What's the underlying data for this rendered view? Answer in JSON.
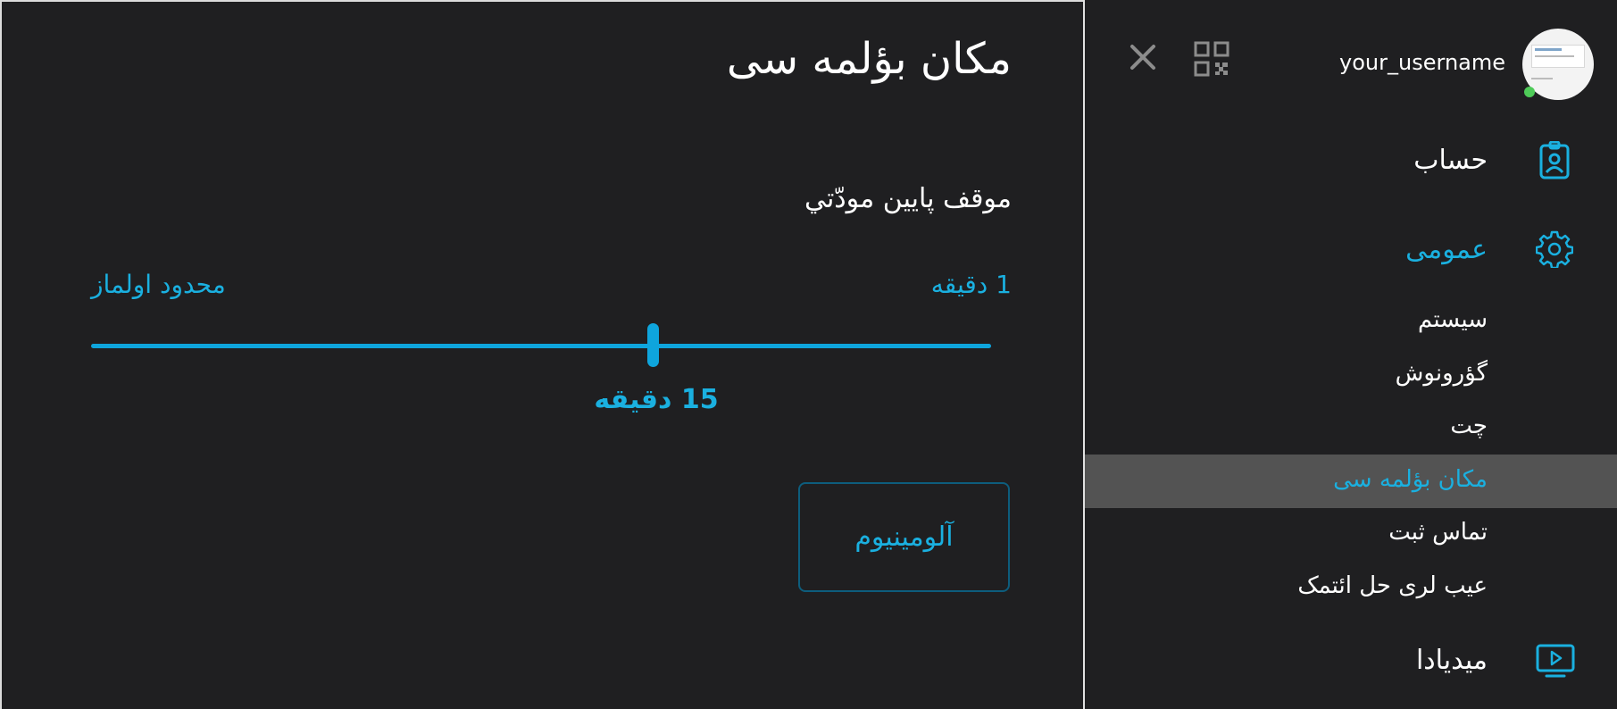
{
  "settings": {
    "title": "مکان بؤلمه سی",
    "setting_label": "موقف پایین مودّتي",
    "range_min_label": "1 دقیقه",
    "range_max_label": "محدود اولماز",
    "slider_value_label": "15 دقیقه",
    "slider_value": 15,
    "button_label": "آلومینیوم"
  },
  "sidebar": {
    "username": "your_username",
    "nav": [
      {
        "label": "حساب",
        "icon": "id-badge-icon"
      },
      {
        "label": "عمومی",
        "icon": "gear-icon"
      },
      {
        "label": "میدیادا",
        "icon": "play-screen-icon"
      }
    ],
    "sub_items": [
      {
        "label": "سیستم"
      },
      {
        "label": "گؤرونوش"
      },
      {
        "label": "چت"
      },
      {
        "label": "مکان بؤلمه سی"
      },
      {
        "label": "تماس ثبت"
      },
      {
        "label": "عیب لری حل ائتمک"
      }
    ]
  },
  "colors": {
    "accent": "#1ab0e0",
    "background": "#1f1f21",
    "selected_row": "#535353",
    "online_status": "#4ecb58"
  }
}
